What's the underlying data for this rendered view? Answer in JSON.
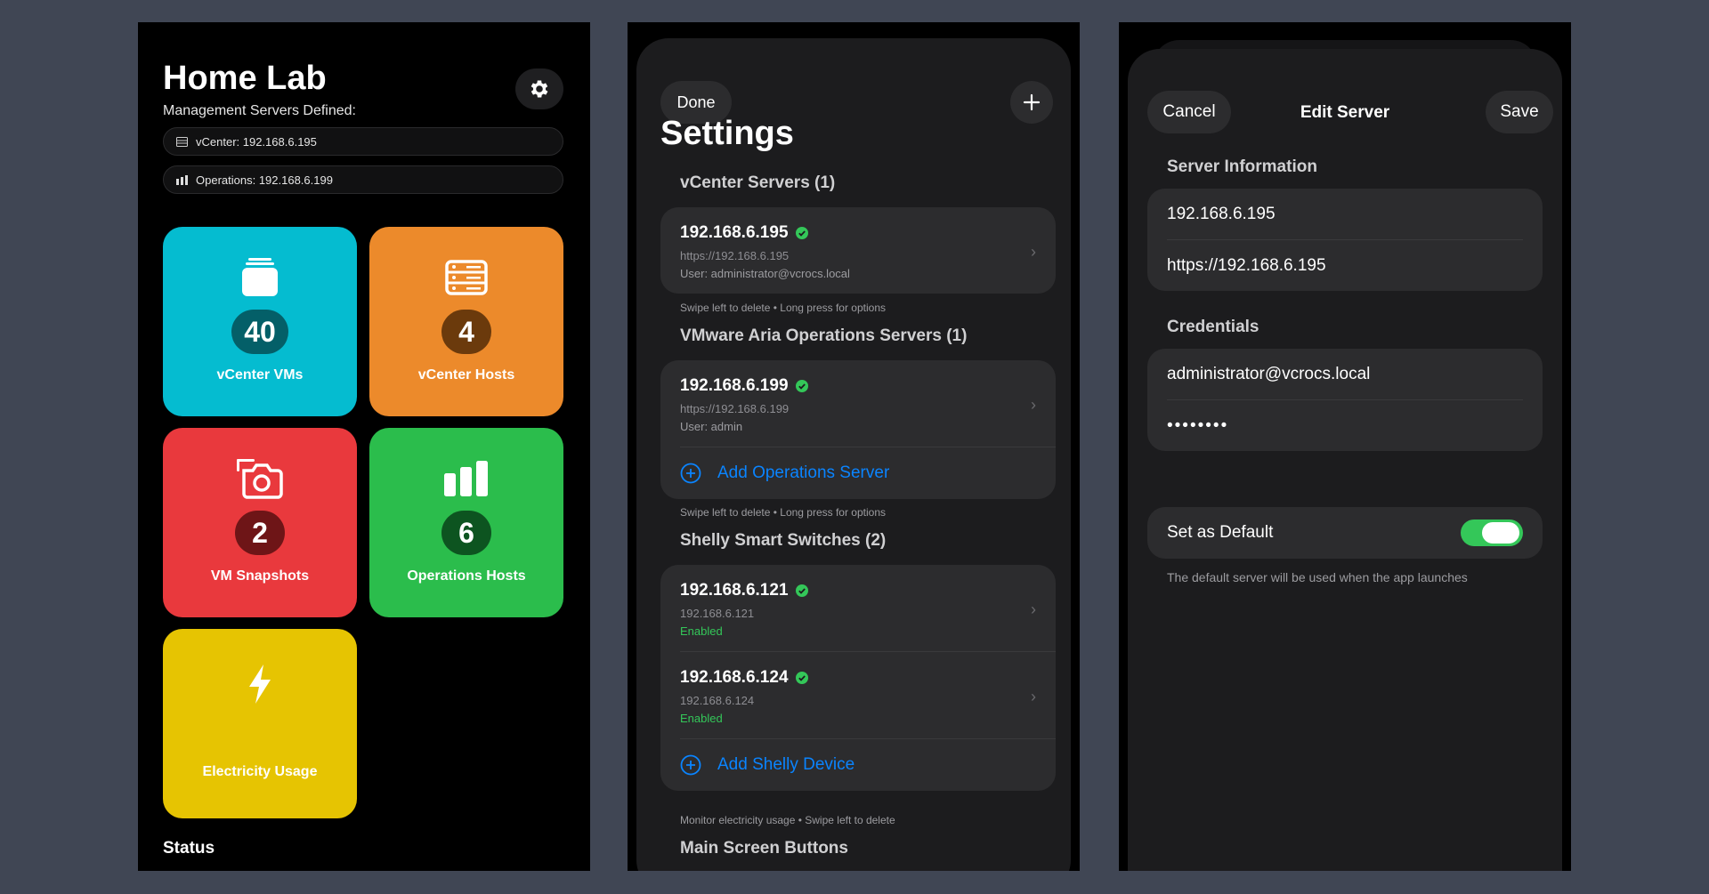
{
  "home": {
    "title": "Home Lab",
    "subtitle": "Management Servers Defined:",
    "servers": [
      {
        "label": "vCenter: 192.168.6.195"
      },
      {
        "label": "Operations: 192.168.6.199"
      }
    ],
    "tiles": [
      {
        "count": "40",
        "label": "vCenter VMs",
        "color": "#05bcd0",
        "badge": "#045f68"
      },
      {
        "count": "4",
        "label": "vCenter Hosts",
        "color": "#ec8a2b",
        "badge": "#6b3a0c"
      },
      {
        "count": "2",
        "label": "VM Snapshots",
        "color": "#e9393d",
        "badge": "#6e1517"
      },
      {
        "count": "6",
        "label": "Operations Hosts",
        "color": "#2bbd4c",
        "badge": "#0d5420"
      },
      {
        "label": "Electricity Usage",
        "color": "#e6c402"
      }
    ],
    "status_heading": "Status"
  },
  "settings": {
    "done": "Done",
    "title": "Settings",
    "vcenter": {
      "heading": "vCenter Servers (1)",
      "items": [
        {
          "ip": "192.168.6.195",
          "url": "https://192.168.6.195",
          "user": "User: administrator@vcrocs.local"
        }
      ],
      "hint": "Swipe left to delete • Long press for options"
    },
    "aria": {
      "heading": "VMware Aria Operations Servers (1)",
      "items": [
        {
          "ip": "192.168.6.199",
          "url": "https://192.168.6.199",
          "user": "User: admin"
        }
      ],
      "add": "Add Operations Server",
      "hint": "Swipe left to delete • Long press for options"
    },
    "shelly": {
      "heading": "Shelly Smart Switches (2)",
      "items": [
        {
          "ip": "192.168.6.121",
          "addr": "192.168.6.121",
          "state": "Enabled"
        },
        {
          "ip": "192.168.6.124",
          "addr": "192.168.6.124",
          "state": "Enabled"
        }
      ],
      "add": "Add Shelly Device",
      "hint": "Monitor electricity usage • Swipe left to delete"
    },
    "main_buttons": {
      "heading": "Main Screen Buttons"
    }
  },
  "edit": {
    "cancel": "Cancel",
    "title": "Edit Server",
    "save": "Save",
    "server_info": {
      "heading": "Server Information",
      "host": "192.168.6.195",
      "url": "https://192.168.6.195"
    },
    "credentials": {
      "heading": "Credentials",
      "user": "administrator@vcrocs.local",
      "password": "••••••••"
    },
    "default": {
      "label": "Set as Default",
      "on": true,
      "hint": "The default server will be used when the app launches"
    }
  }
}
